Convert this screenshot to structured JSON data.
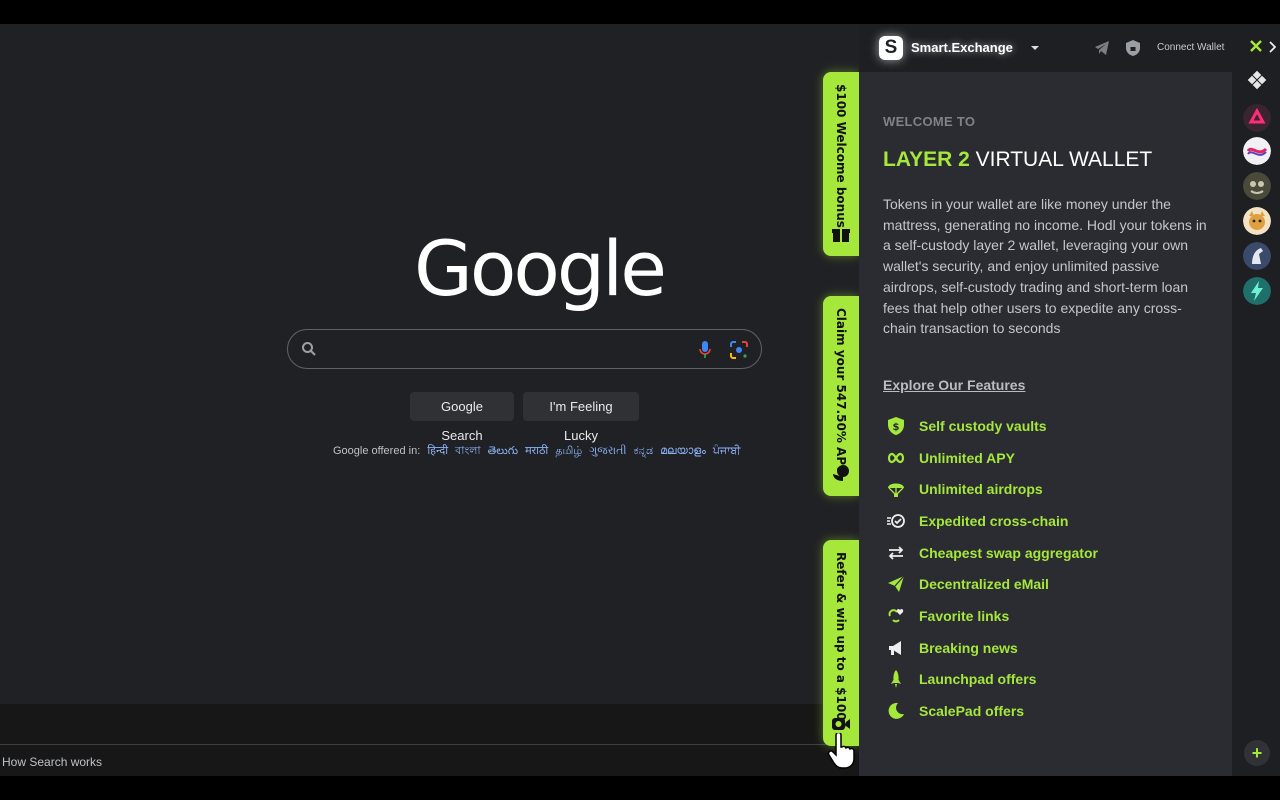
{
  "google": {
    "logo_text": "Google",
    "search": {
      "value": "",
      "placeholder": ""
    },
    "buttons": {
      "search": "Google Search",
      "lucky": "I'm Feeling Lucky"
    },
    "offered_label": "Google offered in:",
    "languages": [
      "हिन्दी",
      "বাংলা",
      "తెలుగు",
      "मराठी",
      "தமிழ்",
      "ગુજરાતી",
      "ಕನ್ನಡ",
      "മലയാളം",
      "ਪੰਜਾਬੀ"
    ],
    "footer_link": "How Search works"
  },
  "side_tabs": [
    {
      "label": "$100 Welcome bonus",
      "icon": "gift-icon"
    },
    {
      "label": "Claim your 547.50% APY",
      "icon": "piggy-icon"
    },
    {
      "label": "Refer & win up to a $1000",
      "icon": "camera-icon"
    }
  ],
  "panel": {
    "brand_name": "Smart.Exchange",
    "brand_letter": "S",
    "connect_wallet": "Connect Wallet",
    "welcome": "WELCOME TO",
    "title_accent": "LAYER 2",
    "title_rest": " VIRTUAL WALLET",
    "description": "Tokens in your wallet are like money under the mattress, generating no income. Hodl your tokens in a self-custody layer 2 wallet, leveraging your own wallet's security, and enjoy unlimited passive airdrops, self-custody trading and short-term loan fees that help other users to expedite any cross-chain transaction to seconds",
    "explore": "Explore Our Features",
    "features": [
      {
        "label": "Self custody vaults",
        "icon": "shield-dollar-icon"
      },
      {
        "label": "Unlimited APY",
        "icon": "infinity-icon"
      },
      {
        "label": "Unlimited airdrops",
        "icon": "parachute-icon"
      },
      {
        "label": "Expedited cross-chain",
        "icon": "fast-check-icon"
      },
      {
        "label": "Cheapest swap aggregator",
        "icon": "swap-arrows-icon"
      },
      {
        "label": "Decentralized eMail",
        "icon": "paper-plane-icon"
      },
      {
        "label": "Favorite links",
        "icon": "link-heart-icon"
      },
      {
        "label": "Breaking news",
        "icon": "megaphone-icon"
      },
      {
        "label": "Launchpad offers",
        "icon": "rocket-icon"
      },
      {
        "label": "ScalePad offers",
        "icon": "moon-icon"
      }
    ]
  },
  "rail": {
    "plus": "+",
    "icons": [
      "grid-app-icon",
      "token-red-icon",
      "token-wave-icon",
      "token-pepe-icon",
      "token-shiba-icon",
      "token-horse-icon",
      "token-bolt-icon"
    ]
  },
  "colors": {
    "accent": "#a5e73b",
    "panel_bg": "#2a2c31",
    "google_bg": "#202124"
  }
}
